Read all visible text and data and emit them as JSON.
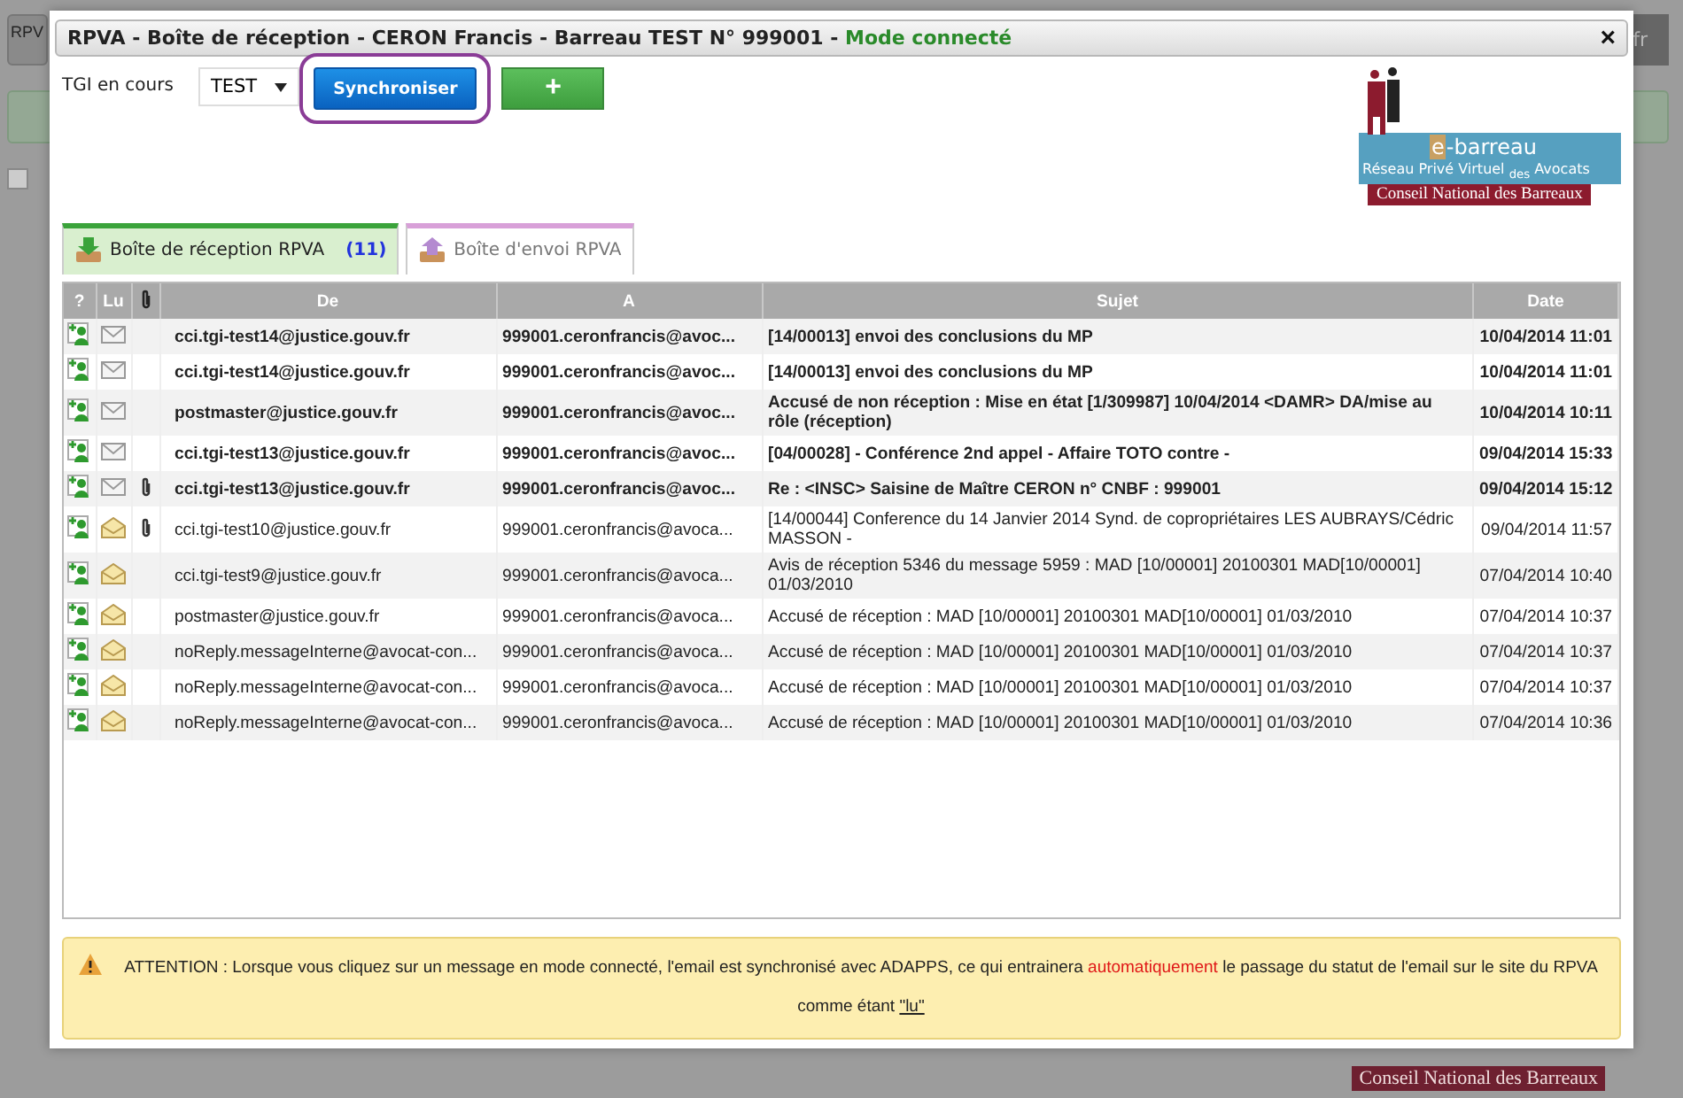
{
  "background": {
    "button": "RPV",
    "lang": "fr",
    "checkbox_checked": false,
    "footer_logo": "Conseil National des Barreaux"
  },
  "window": {
    "title": "RPVA - Boîte de réception - CERON Francis - Barreau TEST N° 999001 - ",
    "mode": "Mode connecté",
    "close": "×"
  },
  "toolbar": {
    "label": "TGI en cours",
    "select": "TEST",
    "sync_button": "Synchroniser",
    "add_button": "+"
  },
  "logo": {
    "mark": "e",
    "name": "-barreau",
    "subtitle": "Réseau Privé Virtuel $_{des}$ Avocats",
    "footer": "Conseil National des Barreaux"
  },
  "tabs": [
    {
      "label": "Boîte de réception RPVA",
      "count": "(11)",
      "selected": true,
      "kind": "inbox"
    },
    {
      "label": "Boîte d'envoi RPVA",
      "selected": false,
      "kind": "outbox"
    }
  ],
  "table": {
    "columns": [
      "?",
      "Lu",
      "De",
      "A",
      "Sujet",
      "Date"
    ],
    "rows": [
      {
        "from": "cci.tgi-test14@justice.gouv.fr",
        "to": "999001.ceronfrancis@avoc...",
        "subject": "[14/00013] envoi des conclusions du MP",
        "date": "10/04/2014 11:01",
        "read": false,
        "attachment": false
      },
      {
        "from": "cci.tgi-test14@justice.gouv.fr",
        "to": "999001.ceronfrancis@avoc...",
        "subject": "[14/00013] envoi des conclusions du MP",
        "date": "10/04/2014 11:01",
        "read": false,
        "attachment": false
      },
      {
        "from": "postmaster@justice.gouv.fr",
        "to": "999001.ceronfrancis@avoc...",
        "subject": "Accusé de non réception : Mise en état [1/309987] 10/04/2014 <DAMR> DA/mise au rôle (réception)",
        "date": "10/04/2014 10:11",
        "read": false,
        "attachment": false
      },
      {
        "from": "cci.tgi-test13@justice.gouv.fr",
        "to": "999001.ceronfrancis@avoc...",
        "subject": "[04/00028] - Conférence 2nd appel - Affaire TOTO contre -",
        "date": "09/04/2014 15:33",
        "read": false,
        "attachment": false
      },
      {
        "from": "cci.tgi-test13@justice.gouv.fr",
        "to": "999001.ceronfrancis@avoc...",
        "subject": "Re : <INSC> Saisine de Maître CERON n° CNBF : 999001",
        "date": "09/04/2014 15:12",
        "read": false,
        "attachment": true
      },
      {
        "from": "cci.tgi-test10@justice.gouv.fr",
        "to": "999001.ceronfrancis@avoca...",
        "subject": "[14/00044] Conference du 14 Janvier 2014 Synd. de copropriétaires LES AUBRAYS/Cédric MASSON -",
        "date": "09/04/2014 11:57",
        "read": true,
        "attachment": true
      },
      {
        "from": "cci.tgi-test9@justice.gouv.fr",
        "to": "999001.ceronfrancis@avoca...",
        "subject": "Avis de réception 5346 du message 5959 : MAD [10/00001] 20100301 MAD[10/00001] 01/03/2010",
        "date": "07/04/2014 10:40",
        "read": true,
        "attachment": false
      },
      {
        "from": "postmaster@justice.gouv.fr",
        "to": "999001.ceronfrancis@avoca...",
        "subject": "Accusé de réception : MAD [10/00001] 20100301 MAD[10/00001] 01/03/2010",
        "date": "07/04/2014 10:37",
        "read": true,
        "attachment": false
      },
      {
        "from": "noReply.messageInterne@avocat-con...",
        "to": "999001.ceronfrancis@avoca...",
        "subject": "Accusé de réception : MAD [10/00001] 20100301 MAD[10/00001] 01/03/2010",
        "date": "07/04/2014 10:37",
        "read": true,
        "attachment": false
      },
      {
        "from": "noReply.messageInterne@avocat-con...",
        "to": "999001.ceronfrancis@avoca...",
        "subject": "Accusé de réception : MAD [10/00001] 20100301 MAD[10/00001] 01/03/2010",
        "date": "07/04/2014 10:37",
        "read": true,
        "attachment": false
      },
      {
        "from": "noReply.messageInterne@avocat-con...",
        "to": "999001.ceronfrancis@avoca...",
        "subject": "Accusé de réception : MAD [10/00001] 20100301 MAD[10/00001] 01/03/2010",
        "date": "07/04/2014 10:36",
        "read": true,
        "attachment": false
      }
    ]
  },
  "alert": {
    "text": "ATTENTION : Lorsque vous cliquez sur un message en mode connecté, l'email est synchronisé avec ADAPPS, ce qui entrainera",
    "highlight": "automatiquement",
    "text_after": "le passage du statut de l'email sur le site du RPVA comme étant",
    "link": "\"lu\""
  }
}
